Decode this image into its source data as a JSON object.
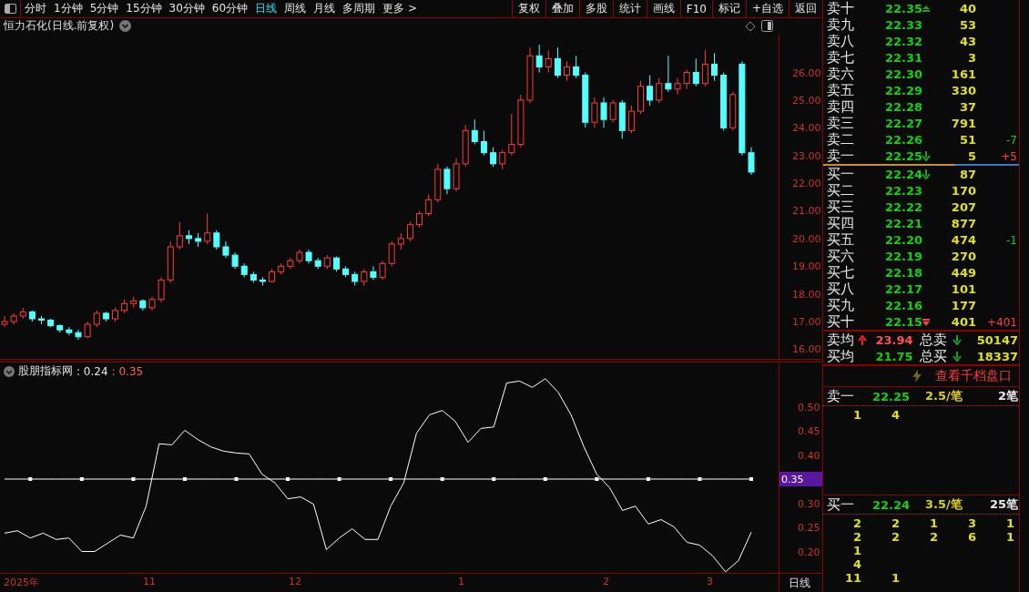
{
  "toolbar": {
    "periods": [
      {
        "label": "分时",
        "selected": false
      },
      {
        "label": "1分钟",
        "selected": false
      },
      {
        "label": "5分钟",
        "selected": false
      },
      {
        "label": "15分钟",
        "selected": false
      },
      {
        "label": "30分钟",
        "selected": false
      },
      {
        "label": "60分钟",
        "selected": false
      },
      {
        "label": "日线",
        "selected": true
      },
      {
        "label": "周线",
        "selected": false
      },
      {
        "label": "月线",
        "selected": false
      },
      {
        "label": "多周期",
        "selected": false
      }
    ],
    "more": "更多 >",
    "buttons": [
      "复权",
      "叠加",
      "多股",
      "统计",
      "画线",
      "F10",
      "标记",
      "+自选",
      "返回"
    ]
  },
  "chart": {
    "title": "恒力石化(日线.前复权)",
    "chart_data": {
      "type": "candlestick",
      "ylim": [
        15.62,
        27.4
      ],
      "yticks": [
        {
          "value": 26,
          "label": "26.00"
        },
        {
          "value": 25,
          "label": "25.00"
        },
        {
          "value": 24,
          "label": "24.00"
        },
        {
          "value": 23,
          "label": "23.00"
        },
        {
          "value": 22,
          "label": "22.00"
        },
        {
          "value": 21,
          "label": "21.00"
        },
        {
          "value": 20,
          "label": "20.00"
        },
        {
          "value": 19,
          "label": "19.00"
        },
        {
          "value": 18,
          "label": "18.00"
        },
        {
          "value": 17,
          "label": "17.00"
        },
        {
          "value": 16,
          "label": "16.00"
        }
      ],
      "ohlc": [
        [
          16.9,
          17.2,
          16.8,
          17.0
        ],
        [
          17.0,
          17.3,
          16.9,
          17.2
        ],
        [
          17.2,
          17.5,
          17.1,
          17.35
        ],
        [
          17.35,
          17.4,
          17.0,
          17.1
        ],
        [
          17.1,
          17.2,
          16.9,
          17.05
        ],
        [
          17.05,
          17.1,
          16.8,
          16.85
        ],
        [
          16.85,
          16.9,
          16.6,
          16.7
        ],
        [
          16.7,
          16.8,
          16.5,
          16.6
        ],
        [
          16.6,
          16.7,
          16.35,
          16.45
        ],
        [
          16.45,
          17.0,
          16.4,
          16.9
        ],
        [
          16.9,
          17.4,
          16.8,
          17.3
        ],
        [
          17.3,
          17.35,
          17.0,
          17.1
        ],
        [
          17.1,
          17.5,
          17.0,
          17.4
        ],
        [
          17.4,
          17.8,
          17.3,
          17.65
        ],
        [
          17.65,
          17.9,
          17.5,
          17.75
        ],
        [
          17.75,
          17.8,
          17.4,
          17.5
        ],
        [
          17.5,
          17.9,
          17.4,
          17.8
        ],
        [
          17.8,
          18.6,
          17.7,
          18.5
        ],
        [
          18.5,
          19.9,
          18.4,
          19.7
        ],
        [
          19.7,
          20.6,
          19.6,
          20.1
        ],
        [
          20.1,
          20.3,
          19.8,
          20.0
        ],
        [
          20.0,
          20.2,
          19.7,
          19.9
        ],
        [
          19.9,
          20.9,
          19.8,
          20.2
        ],
        [
          20.2,
          20.3,
          19.6,
          19.7
        ],
        [
          19.7,
          19.9,
          19.3,
          19.4
        ],
        [
          19.4,
          19.5,
          18.9,
          19.0
        ],
        [
          19.0,
          19.1,
          18.6,
          18.7
        ],
        [
          18.7,
          18.8,
          18.4,
          18.5
        ],
        [
          18.5,
          18.6,
          18.3,
          18.45
        ],
        [
          18.45,
          18.9,
          18.4,
          18.8
        ],
        [
          18.8,
          19.1,
          18.7,
          19.0
        ],
        [
          19.0,
          19.3,
          18.9,
          19.2
        ],
        [
          19.2,
          19.6,
          19.1,
          19.5
        ],
        [
          19.5,
          19.6,
          19.1,
          19.2
        ],
        [
          19.2,
          19.3,
          18.9,
          19.0
        ],
        [
          19.0,
          19.4,
          18.9,
          19.3
        ],
        [
          19.3,
          19.35,
          18.8,
          18.9
        ],
        [
          18.9,
          19.0,
          18.6,
          18.7
        ],
        [
          18.7,
          18.8,
          18.3,
          18.45
        ],
        [
          18.45,
          18.9,
          18.3,
          18.8
        ],
        [
          18.8,
          19.0,
          18.5,
          18.6
        ],
        [
          18.6,
          19.2,
          18.5,
          19.1
        ],
        [
          19.1,
          19.9,
          19.0,
          19.8
        ],
        [
          19.8,
          20.2,
          19.6,
          20.0
        ],
        [
          20.0,
          20.6,
          19.9,
          20.5
        ],
        [
          20.5,
          21.0,
          20.4,
          20.9
        ],
        [
          20.9,
          21.6,
          20.8,
          21.4
        ],
        [
          21.4,
          22.7,
          21.3,
          22.5
        ],
        [
          22.5,
          22.6,
          21.6,
          21.8
        ],
        [
          21.8,
          22.9,
          21.7,
          22.7
        ],
        [
          22.7,
          24.1,
          22.6,
          23.9
        ],
        [
          23.9,
          24.3,
          23.4,
          23.5
        ],
        [
          23.5,
          23.9,
          23.0,
          23.1
        ],
        [
          23.1,
          23.3,
          22.6,
          22.7
        ],
        [
          22.7,
          23.2,
          22.5,
          23.1
        ],
        [
          23.1,
          24.5,
          23.0,
          23.4
        ],
        [
          23.4,
          25.2,
          23.3,
          25.0
        ],
        [
          25.0,
          26.9,
          24.9,
          26.6
        ],
        [
          26.6,
          27.0,
          26.0,
          26.2
        ],
        [
          26.2,
          26.8,
          26.0,
          26.5
        ],
        [
          26.5,
          26.9,
          25.8,
          25.9
        ],
        [
          25.9,
          26.4,
          25.7,
          26.2
        ],
        [
          26.2,
          26.6,
          25.8,
          25.9
        ],
        [
          25.9,
          26.0,
          24.0,
          24.2
        ],
        [
          24.2,
          25.1,
          24.0,
          24.9
        ],
        [
          24.9,
          25.1,
          24.0,
          24.3
        ],
        [
          24.3,
          25.0,
          24.2,
          24.9
        ],
        [
          24.9,
          25.0,
          23.6,
          23.9
        ],
        [
          23.9,
          24.8,
          23.8,
          24.6
        ],
        [
          24.6,
          25.7,
          24.5,
          25.5
        ],
        [
          25.5,
          25.9,
          24.8,
          25.0
        ],
        [
          25.0,
          25.8,
          24.9,
          25.6
        ],
        [
          25.6,
          26.6,
          25.3,
          25.4
        ],
        [
          25.4,
          25.8,
          25.2,
          25.6
        ],
        [
          25.6,
          26.1,
          25.4,
          26.0
        ],
        [
          26.0,
          26.5,
          25.5,
          25.6
        ],
        [
          25.6,
          26.8,
          25.5,
          26.3
        ],
        [
          26.3,
          26.7,
          25.7,
          25.9
        ],
        [
          25.9,
          26.0,
          23.9,
          24.0
        ],
        [
          24.0,
          25.3,
          23.9,
          25.2
        ],
        [
          26.3,
          26.4,
          23.0,
          23.1
        ],
        [
          23.1,
          23.3,
          22.3,
          22.4
        ]
      ]
    }
  },
  "indicator": {
    "name": "股朋指标网",
    "readings": [
      {
        "text": ": 0.24",
        "kind": "main"
      },
      {
        "text": ": 0.35",
        "kind": "signal"
      }
    ],
    "current_label": "0.35",
    "chart_data": {
      "type": "line",
      "ylim": [
        0.1538,
        0.5934
      ],
      "yticks": [
        {
          "value": 0.2,
          "label": "0.20"
        },
        {
          "value": 0.25,
          "label": "0.25"
        },
        {
          "value": 0.3,
          "label": "0.30"
        },
        {
          "value": 0.4,
          "label": "0.40"
        },
        {
          "value": 0.45,
          "label": "0.45"
        },
        {
          "value": 0.5,
          "label": "0.50"
        }
      ],
      "series": [
        {
          "color": "#ffffff",
          "values": [
            0.238,
            0.243,
            0.228,
            0.238,
            0.225,
            0.228,
            0.2,
            0.2,
            0.217,
            0.234,
            0.228,
            0.294,
            0.423,
            0.421,
            0.451,
            0.432,
            0.417,
            0.408,
            0.404,
            0.402,
            0.36,
            0.342,
            0.309,
            0.313,
            0.298,
            0.204,
            0.228,
            0.247,
            0.225,
            0.225,
            0.294,
            0.342,
            0.445,
            0.483,
            0.492,
            0.47,
            0.426,
            0.455,
            0.458,
            0.549,
            0.553,
            0.54,
            0.558,
            0.53,
            0.483,
            0.417,
            0.36,
            0.332,
            0.285,
            0.294,
            0.257,
            0.266,
            0.251,
            0.219,
            0.213,
            0.191,
            0.158,
            0.181,
            0.24
          ]
        },
        {
          "color": "#ffffff",
          "values": [
            0.35,
            0.35,
            0.35,
            0.35,
            0.35,
            0.35,
            0.35,
            0.35,
            0.35,
            0.35,
            0.35,
            0.35,
            0.35,
            0.35,
            0.35,
            0.35,
            0.35,
            0.35,
            0.35,
            0.35,
            0.35,
            0.35,
            0.35,
            0.35,
            0.35,
            0.35,
            0.35,
            0.35,
            0.35,
            0.35,
            0.35,
            0.35,
            0.35,
            0.35,
            0.35,
            0.35,
            0.35,
            0.35,
            0.35,
            0.35,
            0.35,
            0.35,
            0.35,
            0.35,
            0.35,
            0.35,
            0.35,
            0.35,
            0.35,
            0.35,
            0.35,
            0.35,
            0.35,
            0.35,
            0.35,
            0.35,
            0.35,
            0.35,
            0.35
          ]
        }
      ]
    }
  },
  "date_axis": {
    "labels": [
      "2025年",
      "11",
      "12",
      "1",
      "2",
      "3"
    ],
    "period": "日线"
  },
  "order_book": {
    "asks": [
      {
        "label": "卖十",
        "price": "22.35",
        "volume": "40",
        "kind": "up-limit"
      },
      {
        "label": "卖九",
        "price": "22.33",
        "volume": "53",
        "kind": "plain"
      },
      {
        "label": "卖八",
        "price": "22.32",
        "volume": "43",
        "kind": "plain"
      },
      {
        "label": "卖七",
        "price": "22.31",
        "volume": "3",
        "kind": "plain"
      },
      {
        "label": "卖六",
        "price": "22.30",
        "volume": "161",
        "kind": "plain"
      },
      {
        "label": "卖五",
        "price": "22.29",
        "volume": "330",
        "kind": "plain"
      },
      {
        "label": "卖四",
        "price": "22.28",
        "volume": "37",
        "kind": "plain"
      },
      {
        "label": "卖三",
        "price": "22.27",
        "volume": "791",
        "kind": "plain"
      },
      {
        "label": "卖二",
        "price": "22.26",
        "volume": "51",
        "kind": "plain",
        "change": "-7",
        "rising": false
      },
      {
        "label": "卖一",
        "price": "22.25",
        "volume": "5",
        "kind": "down",
        "change": "+5",
        "rising": true
      }
    ],
    "bids": [
      {
        "label": "买一",
        "price": "22.24",
        "volume": "87",
        "kind": "down"
      },
      {
        "label": "买二",
        "price": "22.23",
        "volume": "170",
        "kind": "plain"
      },
      {
        "label": "买三",
        "price": "22.22",
        "volume": "207",
        "kind": "plain"
      },
      {
        "label": "买四",
        "price": "22.21",
        "volume": "877",
        "kind": "plain"
      },
      {
        "label": "买五",
        "price": "22.20",
        "volume": "474",
        "kind": "plain",
        "change": "-1",
        "rising": false
      },
      {
        "label": "买六",
        "price": "22.19",
        "volume": "270",
        "kind": "plain"
      },
      {
        "label": "买七",
        "price": "22.18",
        "volume": "449",
        "kind": "plain"
      },
      {
        "label": "买八",
        "price": "22.17",
        "volume": "101",
        "kind": "plain"
      },
      {
        "label": "买九",
        "price": "22.16",
        "volume": "177",
        "kind": "plain"
      },
      {
        "label": "买十",
        "price": "22.15",
        "volume": "401",
        "kind": "down-limit",
        "change": "+401",
        "rising": true
      }
    ],
    "summary": [
      {
        "label": "卖均",
        "kind": "up",
        "value": "23.94",
        "rising": true,
        "total_label": "总卖",
        "total_falling": true,
        "total": "50147"
      },
      {
        "label": "买均",
        "kind": "plain",
        "value": "21.75",
        "rising": false,
        "total_label": "总买",
        "total_falling": true,
        "total": "18337"
      }
    ]
  },
  "queue": {
    "link": "查看千档盘口",
    "blocks": [
      {
        "label": "卖一",
        "price": "22.25",
        "avg": "2.5/笔",
        "count": "2笔",
        "rows": [
          [
            "1",
            "4"
          ]
        ]
      },
      {
        "label": "买一",
        "price": "22.24",
        "avg": "3.5/笔",
        "count": "25笔",
        "rows": [
          [
            "2",
            "2",
            "1",
            "3",
            "1"
          ],
          [
            "2",
            "2",
            "2",
            "6",
            "1"
          ],
          [
            "1"
          ],
          [
            "4"
          ],
          [
            "11",
            "1"
          ]
        ]
      }
    ]
  }
}
